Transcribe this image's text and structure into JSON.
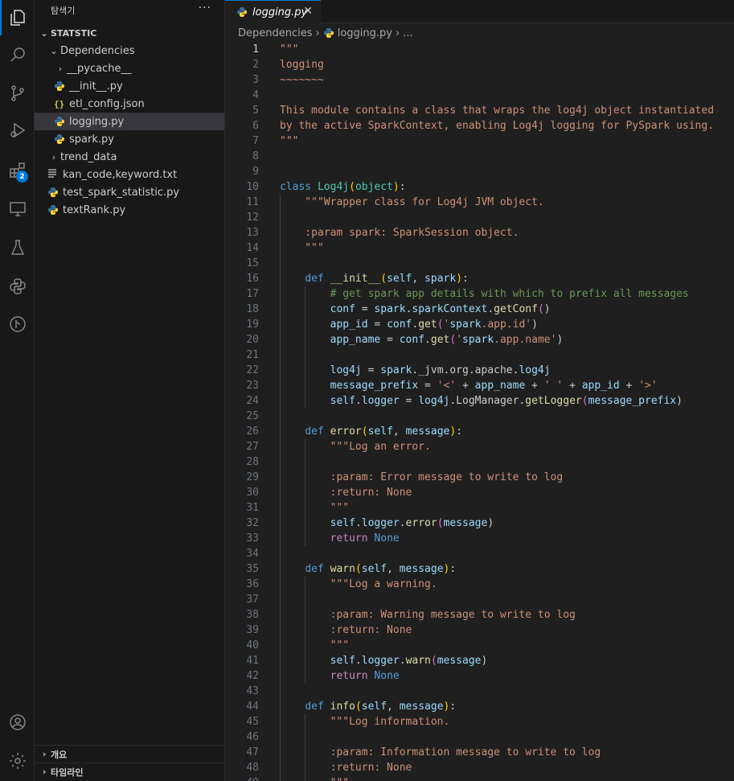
{
  "sidebar": {
    "title": "탐색기",
    "more": "···",
    "root": "STATSTIC",
    "items": [
      {
        "label": "Dependencies",
        "type": "folder-open"
      },
      {
        "label": "__pycache__",
        "type": "folder"
      },
      {
        "label": "__init__.py",
        "type": "py"
      },
      {
        "label": "etl_config.json",
        "type": "json"
      },
      {
        "label": "logging.py",
        "type": "py"
      },
      {
        "label": "spark.py",
        "type": "py"
      },
      {
        "label": "trend_data",
        "type": "folder"
      },
      {
        "label": "kan_code,keyword.txt",
        "type": "txt"
      },
      {
        "label": "test_spark_statistic.py",
        "type": "py"
      },
      {
        "label": "textRank.py",
        "type": "py"
      }
    ],
    "panels": [
      "개요",
      "타임라인"
    ]
  },
  "activity": {
    "extensions_badge": "2",
    "icons": [
      "explorer-icon",
      "search-icon",
      "source-control-icon",
      "run-debug-icon",
      "extensions-icon",
      "remote-explorer-icon",
      "testing-icon",
      "python-icon",
      "git-graph-icon",
      "account-icon",
      "settings-gear-icon"
    ]
  },
  "tab": {
    "label": "logging.py",
    "close": "✕"
  },
  "breadcrumb": {
    "parts": [
      "Dependencies",
      "logging.py",
      "..."
    ]
  },
  "code": {
    "lines": [
      "\"\"\"",
      "logging",
      "~~~~~~~",
      "",
      "This module contains a class that wraps the log4j object instantiated",
      "by the active SparkContext, enabling Log4j logging for PySpark using.",
      "\"\"\"",
      "",
      "",
      "class Log4j(object):",
      "    \"\"\"Wrapper class for Log4j JVM object.",
      "",
      "    :param spark: SparkSession object.",
      "    \"\"\"",
      "",
      "    def __init__(self, spark):",
      "        # get spark app details with which to prefix all messages",
      "        conf = spark.sparkContext.getConf()",
      "        app_id = conf.get('spark.app.id')",
      "        app_name = conf.get('spark.app.name')",
      "",
      "        log4j = spark._jvm.org.apache.log4j",
      "        message_prefix = '<' + app_name + ' ' + app_id + '>'",
      "        self.logger = log4j.LogManager.getLogger(message_prefix)",
      "",
      "    def error(self, message):",
      "        \"\"\"Log an error.",
      "",
      "        :param: Error message to write to log",
      "        :return: None",
      "        \"\"\"",
      "        self.logger.error(message)",
      "        return None",
      "",
      "    def warn(self, message):",
      "        \"\"\"Log a warning.",
      "",
      "        :param: Warning message to write to log",
      "        :return: None",
      "        \"\"\"",
      "        self.logger.warn(message)",
      "        return None",
      "",
      "    def info(self, message):",
      "        \"\"\"Log information.",
      "",
      "        :param: Information message to write to log",
      "        :return: None",
      "        \"\"\""
    ],
    "current_line": 1
  },
  "colors": {
    "accent": "#0078d4",
    "keyword": "#569cd6",
    "string": "#ce9178",
    "comment": "#6a9955",
    "class": "#4ec9b0",
    "function": "#dcdcaa",
    "variable": "#9cdcfe"
  }
}
